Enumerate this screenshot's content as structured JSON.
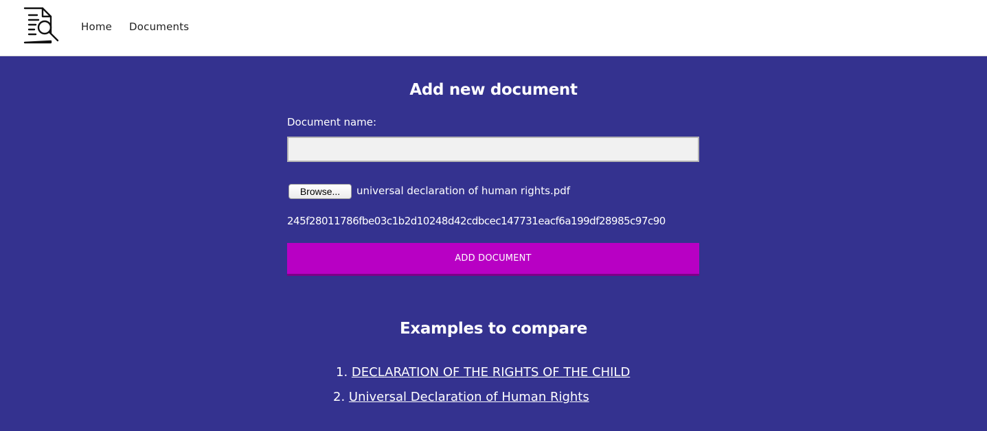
{
  "nav": {
    "logo_icon": "document-search-icon",
    "home_label": "Home",
    "documents_label": "Documents"
  },
  "form": {
    "title": "Add new document",
    "name_label": "Document name:",
    "name_value": "",
    "browse_label": "Browse...",
    "file_name": "universal declaration of human rights.pdf",
    "hash": "245f28011786fbe03c1b2d10248d42cdbcec147731eacf6a199df28985c97c90",
    "submit_label": "ADD DOCUMENT"
  },
  "examples": {
    "title": "Examples to compare",
    "items": [
      {
        "number": "1.",
        "label": "DECLARATION OF THE RIGHTS OF THE CHILD"
      },
      {
        "number": "2.",
        "label": "Universal Declaration of Human Rights"
      }
    ]
  },
  "colors": {
    "background": "#34328f",
    "navbar": "#ffffff",
    "accent_button": "#b800c4",
    "input_background": "#f1f1f1"
  }
}
